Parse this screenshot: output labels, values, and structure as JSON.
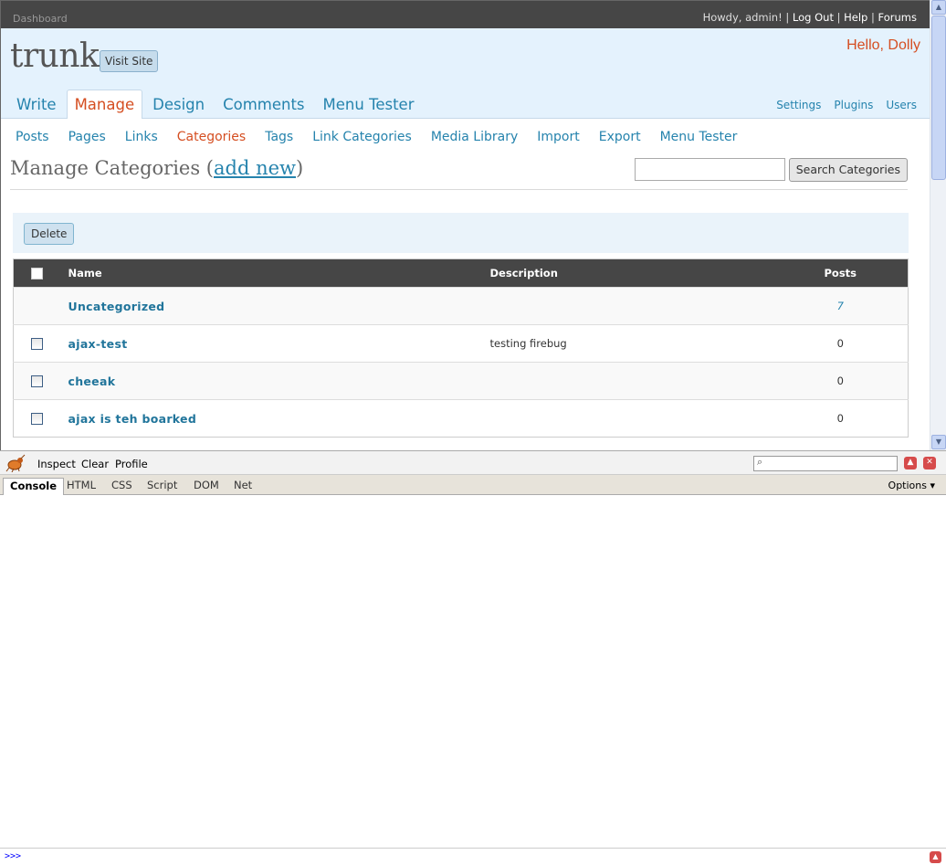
{
  "topbar": {
    "dashboard": "Dashboard",
    "howdy": "Howdy, admin!",
    "logout": "Log Out",
    "help": "Help",
    "forums": "Forums",
    "sep": "|"
  },
  "header": {
    "site_title": "trunk",
    "visit_site": "Visit Site",
    "dolly": "Hello, Dolly"
  },
  "main_tabs": [
    "Write",
    "Manage",
    "Design",
    "Comments",
    "Menu Tester"
  ],
  "side_links": [
    "Settings",
    "Plugins",
    "Users"
  ],
  "submenu": [
    "Posts",
    "Pages",
    "Links",
    "Categories",
    "Tags",
    "Link Categories",
    "Media Library",
    "Import",
    "Export",
    "Menu Tester"
  ],
  "page": {
    "title": "Manage Categories (",
    "add_new": "add new",
    "title_end": ")",
    "search_button": "Search Categories",
    "search_value": "",
    "delete_button": "Delete"
  },
  "table": {
    "headers": {
      "name": "Name",
      "description": "Description",
      "posts": "Posts"
    },
    "rows": [
      {
        "name": "Uncategorized",
        "description": "",
        "posts": "7"
      },
      {
        "name": "ajax-test",
        "description": "testing firebug",
        "posts": "0"
      },
      {
        "name": "cheeak",
        "description": "",
        "posts": "0"
      },
      {
        "name": "ajax is teh boarked",
        "description": "",
        "posts": "0"
      }
    ]
  },
  "firebug": {
    "toolbar": [
      "Inspect",
      "Clear",
      "Profile"
    ],
    "tabs": [
      "Console",
      "HTML",
      "CSS",
      "Script",
      "DOM",
      "Net"
    ],
    "options": "Options ▾",
    "prompt": ">>>",
    "logo_icon": "firebug-icon"
  },
  "colors": {
    "accent": "#2583ad",
    "active": "#d54e21",
    "header_bg": "#e4f2fd",
    "topbar_bg": "#464646"
  }
}
